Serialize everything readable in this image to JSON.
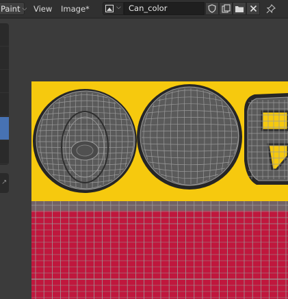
{
  "header": {
    "mode": "Paint",
    "menus": [
      "View",
      "Image*"
    ],
    "image_name": "Can_color",
    "icons": [
      "image-type-icon",
      "fake-user-shield-icon",
      "new-image-icon",
      "open-image-icon",
      "unlink-image-icon",
      "pin-icon"
    ]
  },
  "toolbar": {
    "active_index": 4
  },
  "colors": {
    "label_yellow": "#f6c90e",
    "can_red": "#c0173d",
    "mesh_gray": "#5a5a5a",
    "wire": "#9b9b9b"
  }
}
